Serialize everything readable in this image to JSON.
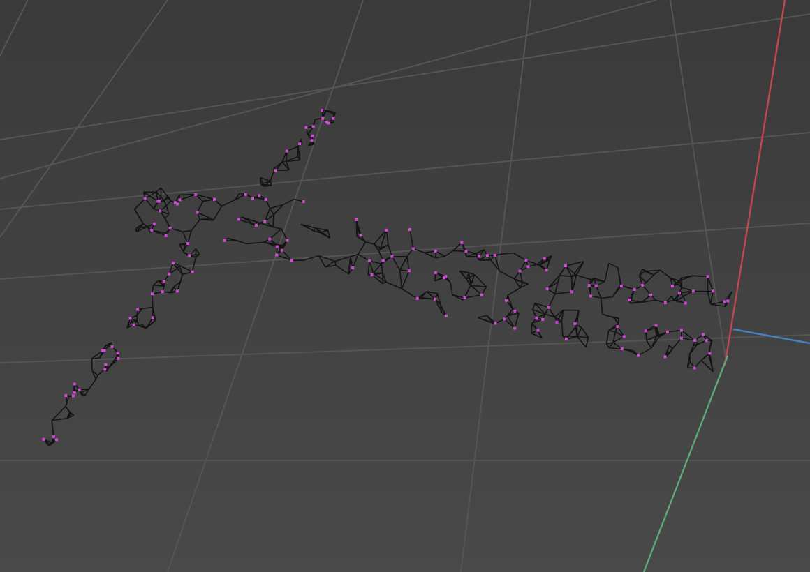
{
  "viewport": {
    "grid": true,
    "vertices_selected": true
  }
}
